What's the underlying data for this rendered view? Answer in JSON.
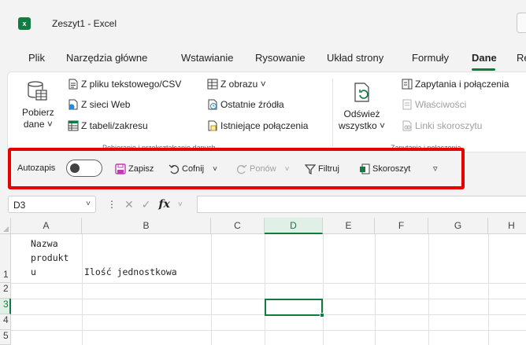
{
  "window": {
    "title": "Zeszyt1  -  Excel",
    "app_icon": "excel-icon"
  },
  "tabs": [
    {
      "label": "Plik"
    },
    {
      "label": "Narzędzia główne"
    },
    {
      "label": "Wstawianie"
    },
    {
      "label": "Rysowanie"
    },
    {
      "label": "Układ strony"
    },
    {
      "label": "Formuły"
    },
    {
      "label": "Dane",
      "active": true
    },
    {
      "label": "Re"
    }
  ],
  "ribbon": {
    "get_data": {
      "label_line1": "Pobierz",
      "label_line2": "dane ˅"
    },
    "from_text_csv": "Z pliku tekstowego/CSV",
    "from_web": "Z sieci Web",
    "from_table": "Z tabeli/zakresu",
    "from_picture": "Z obrazu ˅",
    "recent_sources": "Ostatnie źródła",
    "existing_connections": "Istniejące połączenia",
    "group1_label": "Pobieranie i przekształcanie danych",
    "refresh_all": {
      "label_line1": "Odśwież",
      "label_line2": "wszystko ˅"
    },
    "queries_connections": "Zapytania i połączenia",
    "properties": "Właściwości",
    "edit_links": "Linki skoroszytu",
    "group2_label": "Zapytania i połączenia"
  },
  "quick_access": {
    "autosave_label": "Autozapis",
    "autosave_state": "off",
    "save": "Zapisz",
    "undo": "Cofnij",
    "redo": "Ponów",
    "filter": "Filtruj",
    "workbook": "Skoroszyt",
    "customize": "▿",
    "highlight_color": "#e60000"
  },
  "formula_bar": {
    "name_box": "D3",
    "formula": ""
  },
  "sheet": {
    "columns": [
      "A",
      "B",
      "C",
      "D",
      "E",
      "F",
      "G",
      "H"
    ],
    "rows": [
      "1",
      "2",
      "3",
      "4",
      "5"
    ],
    "active_cell": "D3",
    "cells": {
      "A1": "Nazwa\nprodukt\nu",
      "B1": "Ilość jednostkowa"
    },
    "accent_color": "#107c41"
  }
}
